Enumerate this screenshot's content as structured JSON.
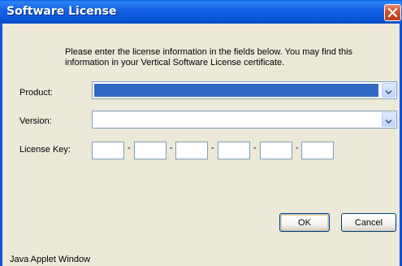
{
  "window": {
    "title": "Software License"
  },
  "intro": "Please enter the license information in the fields below. You may find this information in your Vertical Software License certificate.",
  "fields": {
    "product": {
      "label": "Product:",
      "value": ""
    },
    "version": {
      "label": "Version:",
      "value": ""
    },
    "license_key": {
      "label": "License Key:",
      "separator": "-",
      "segments": [
        "",
        "",
        "",
        "",
        "",
        ""
      ]
    }
  },
  "buttons": {
    "ok": "OK",
    "cancel": "Cancel"
  },
  "status": "Java Applet Window",
  "icons": {
    "close": "close-icon",
    "dropdown": "chevron-down-icon"
  },
  "colors": {
    "title_bar": "#0b54d8",
    "selection": "#316ac5",
    "window_bg": "#ece9d8"
  }
}
